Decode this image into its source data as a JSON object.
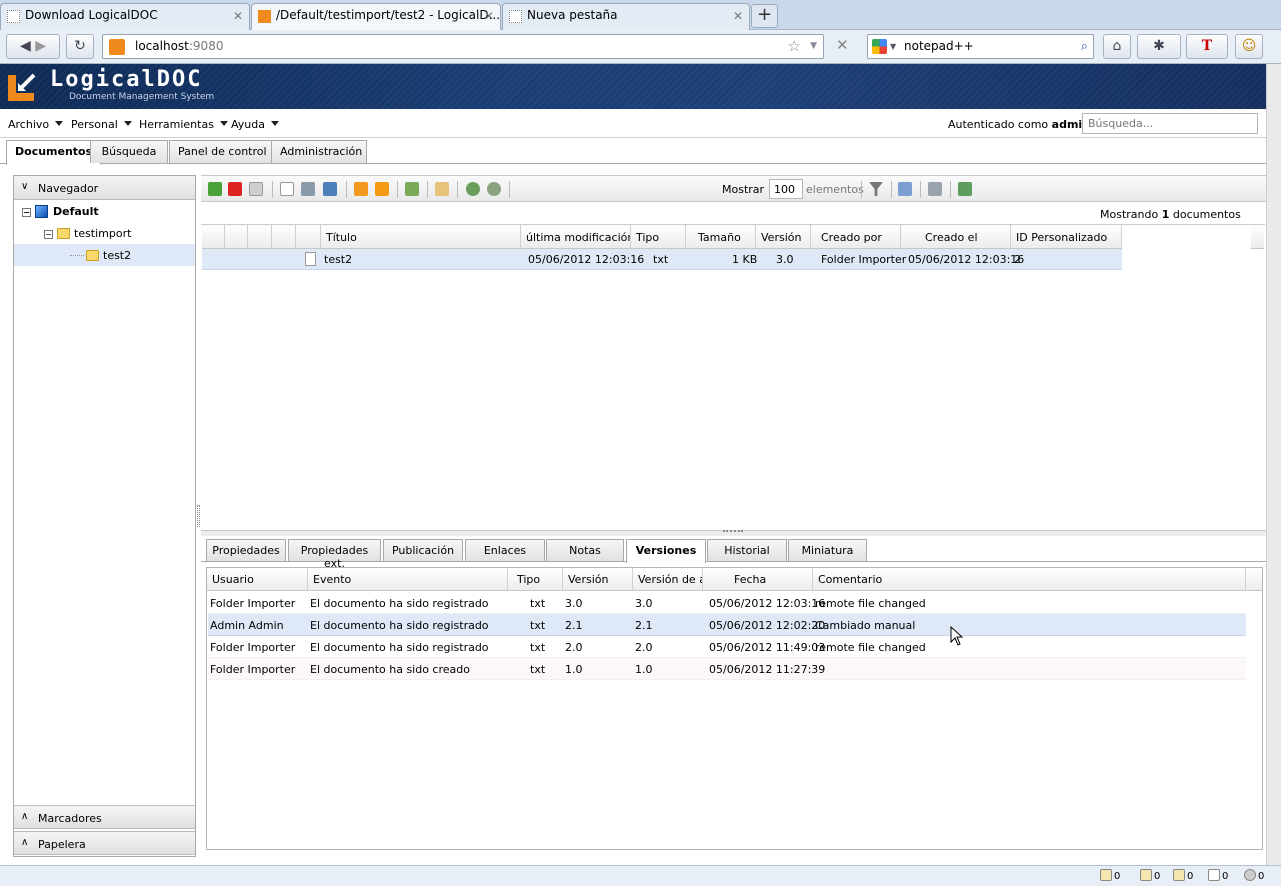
{
  "browser": {
    "tabs": [
      {
        "label": "Download LogicalDOC",
        "active": false
      },
      {
        "label": "/Default/testimport/test2 - LogicalD...",
        "active": true
      },
      {
        "label": "Nueva pestaña",
        "active": false
      }
    ],
    "new_tab": "+",
    "url_host": "localhost",
    "url_port": ":9080",
    "search_text": "notepad++"
  },
  "app": {
    "logo_text": "LogicalDOC",
    "logo_subtitle": "Document Management System",
    "menu": [
      "Archivo",
      "Personal",
      "Herramientas",
      "Ayuda"
    ],
    "auth_prefix": "Autenticado como",
    "auth_user": "admin",
    "search_placeholder": "Búsqueda...",
    "main_tabs": [
      "Documentos",
      "Búsqueda",
      "Panel de control",
      "Administración"
    ],
    "active_main_tab": "Documentos"
  },
  "navigator": {
    "title": "Navegador",
    "tree": [
      {
        "label": "Default",
        "level": 0
      },
      {
        "label": "testimport",
        "level": 1
      },
      {
        "label": "test2",
        "level": 2,
        "selected": true
      }
    ],
    "bookmarks": "Marcadores",
    "trash": "Papelera"
  },
  "toolbar": {
    "show_label": "Mostrar",
    "page_size": "100",
    "elements_label": "elementos"
  },
  "documents": {
    "showing_prefix": "Mostrando",
    "showing_count": "1",
    "showing_suffix": "documentos",
    "columns": [
      "Título",
      "última modificación",
      "Tipo",
      "Tamaño",
      "Versión",
      "Creado por",
      "Creado el",
      "ID Personalizado"
    ],
    "rows": [
      {
        "title": "test2",
        "modified": "05/06/2012 12:03:16",
        "type": "txt",
        "size": "1 KB",
        "version": "3.0",
        "created_by": "Folder Importer",
        "created_on": "05/06/2012 12:03:16",
        "custom_id": "2"
      }
    ]
  },
  "detail_tabs": {
    "tabs": [
      "Propiedades",
      "Propiedades ext.",
      "Publicación",
      "Enlaces",
      "Notas",
      "Versiones",
      "Historial",
      "Miniatura"
    ],
    "active": "Versiones"
  },
  "versions": {
    "columns": [
      "Usuario",
      "Evento",
      "Tipo",
      "Versión",
      "Versión de ar",
      "Fecha",
      "Comentario"
    ],
    "rows": [
      {
        "user": "Folder Importer",
        "event": "El documento ha sido registrado",
        "type": "txt",
        "version": "3.0",
        "file_version": "3.0",
        "date": "05/06/2012 12:03:16",
        "comment": "remote file changed"
      },
      {
        "user": "Admin Admin",
        "event": "El documento ha sido registrado",
        "type": "txt",
        "version": "2.1",
        "file_version": "2.1",
        "date": "05/06/2012 12:02:20",
        "comment": "Cambiado manual"
      },
      {
        "user": "Folder Importer",
        "event": "El documento ha sido registrado",
        "type": "txt",
        "version": "2.0",
        "file_version": "2.0",
        "date": "05/06/2012 11:49:03",
        "comment": "remote file changed"
      },
      {
        "user": "Folder Importer",
        "event": "El documento ha sido creado",
        "type": "txt",
        "version": "1.0",
        "file_version": "1.0",
        "date": "05/06/2012 11:27:39",
        "comment": ""
      }
    ]
  },
  "status": {
    "counters": [
      "0",
      "0",
      "0",
      "0",
      "0"
    ]
  },
  "colors": {
    "header_bg": "#1a3d75",
    "selection": "#dfe8f6"
  }
}
